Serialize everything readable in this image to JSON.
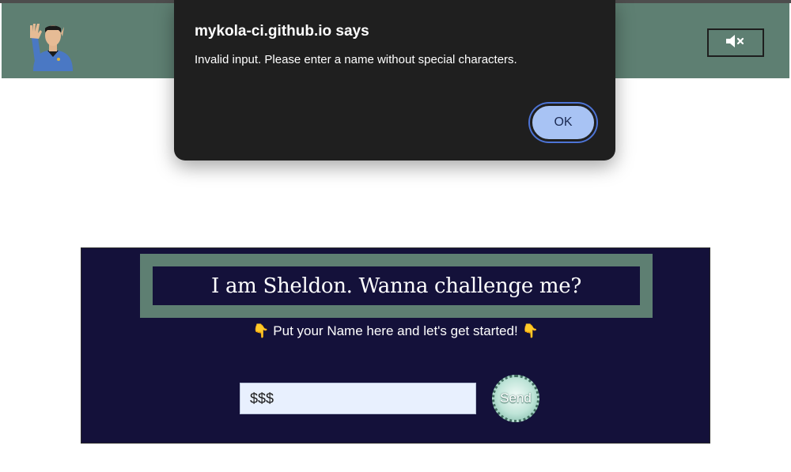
{
  "header": {
    "avatar_icon": "spock-vulcan-salute-avatar",
    "mute_icon": "speaker-muted-icon"
  },
  "game": {
    "title": "I am Sheldon. Wanna challenge me?",
    "prompt_emoji": "👇",
    "prompt": "Put your Name here and let's get started!",
    "name_input_value": "$$$",
    "send_label": "Send"
  },
  "alert": {
    "title": "mykola-ci.github.io says",
    "message": "Invalid input. Please enter a name without special characters.",
    "ok_label": "OK"
  },
  "colors": {
    "header_green": "#5e7f72",
    "panel_navy": "#14113a",
    "dialog_bg": "#1f1f1f",
    "ok_button": "#a8c3f4",
    "input_bg": "#e8f0fe"
  }
}
